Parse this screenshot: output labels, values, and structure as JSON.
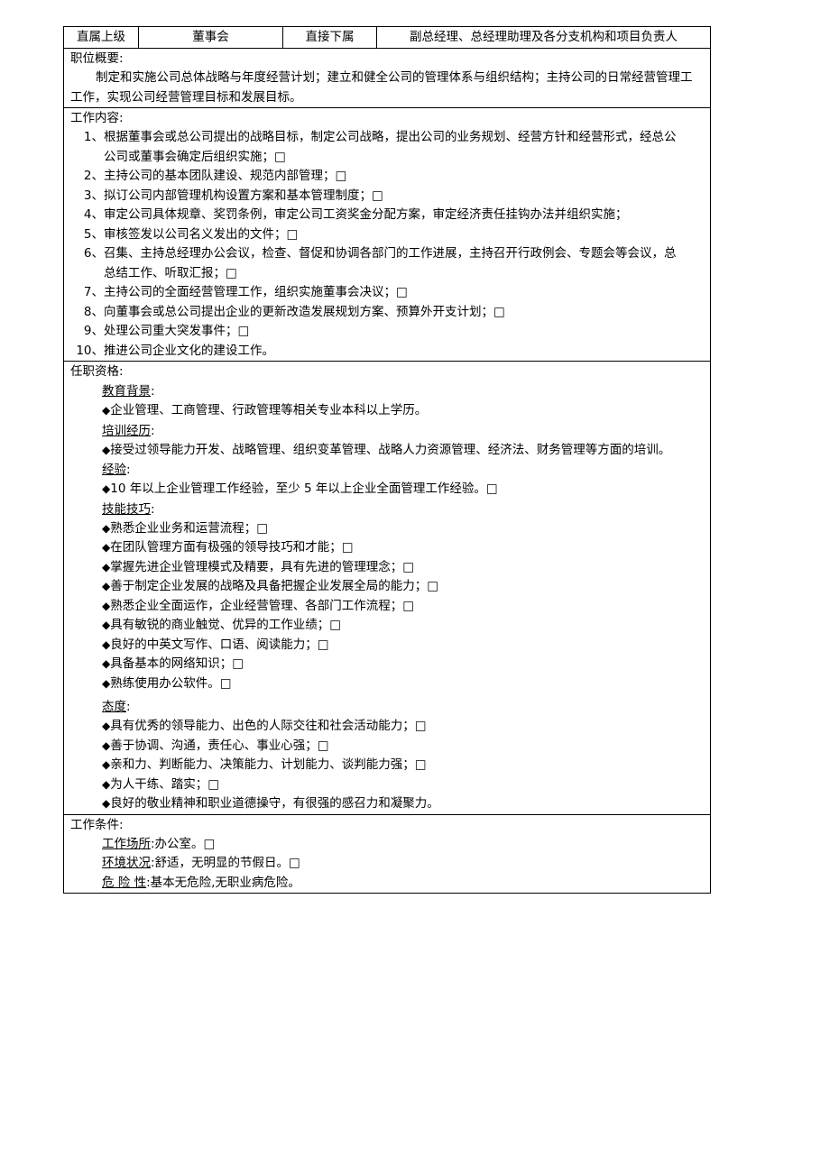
{
  "header": {
    "cells": [
      "直属上级",
      "董事会",
      "直接下属",
      "副总经理、总经理助理及各分支机构和项目负责人"
    ]
  },
  "summary": {
    "title": "职位概要:",
    "line1": "制定和实施公司总体战略与年度经营计划；建立和健全公司的管理体系与组织结构；主持公司的日常经营管理工",
    "line2": "工作，实现公司经营管理目标和发展目标。"
  },
  "duties": {
    "title": "工作内容:",
    "items": [
      {
        "num": "1、",
        "text": "根据董事会或总公司提出的战略目标，制定公司战略，提出公司的业务规划、经营方针和经营形式，经总公",
        "cont": "公司或董事会确定后组织实施；□"
      },
      {
        "num": "2、",
        "text": "主持公司的基本团队建设、规范内部管理；□",
        "cont": ""
      },
      {
        "num": "3、",
        "text": "拟订公司内部管理机构设置方案和基本管理制度；□",
        "cont": ""
      },
      {
        "num": "4、",
        "text": "审定公司具体规章、奖罚条例，审定公司工资奖金分配方案，审定经济责任挂钩办法并组织实施；",
        "cont": ""
      },
      {
        "num": "5、",
        "text": "审核签发以公司名义发出的文件；□",
        "cont": ""
      },
      {
        "num": "6、",
        "text": "召集、主持总经理办公会议，检查、督促和协调各部门的工作进展，主持召开行政例会、专题会等会议，总",
        "cont": "总结工作、听取汇报；□"
      },
      {
        "num": "7、",
        "text": "主持公司的全面经营管理工作，组织实施董事会决议；□",
        "cont": ""
      },
      {
        "num": "8、",
        "text": "向董事会或总公司提出企业的更新改造发展规划方案、预算外开支计划；□",
        "cont": ""
      },
      {
        "num": "9、",
        "text": "处理公司重大突发事件；□",
        "cont": ""
      },
      {
        "num": "10、",
        "text": "推进公司企业文化的建设工作。",
        "cont": ""
      }
    ]
  },
  "qualifications": {
    "title": "任职资格:",
    "groups": [
      {
        "heading": "教育背景",
        "heading_suffix": ":",
        "items": [
          "企业管理、工商管理、行政管理等相关专业本科以上学历。"
        ]
      },
      {
        "heading": "培训经历",
        "heading_suffix": ":",
        "items": [
          "接受过领导能力开发、战略管理、组织变革管理、战略人力资源管理、经济法、财务管理等方面的培训。"
        ]
      },
      {
        "heading": "经验",
        "heading_suffix": ":",
        "items": [
          "10 年以上企业管理工作经验，至少 5 年以上企业全面管理工作经验。□"
        ]
      },
      {
        "heading": "技能技巧",
        "heading_suffix": ":",
        "items": [
          "熟悉企业业务和运营流程；□",
          "在团队管理方面有极强的领导技巧和才能；□",
          "掌握先进企业管理模式及精要，具有先进的管理理念；□",
          "善于制定企业发展的战略及具备把握企业发展全局的能力；□",
          "熟悉企业全面运作，企业经营管理、各部门工作流程；□",
          "具有敏锐的商业触觉、优异的工作业绩；□",
          "良好的中英文写作、口语、阅读能力；□",
          "具备基本的网络知识；□",
          "熟练使用办公软件。□"
        ]
      },
      {
        "heading": "态度",
        "heading_suffix": ":",
        "items": [
          "具有优秀的领导能力、出色的人际交往和社会活动能力；□",
          "善于协调、沟通，责任心、事业心强；□",
          "亲和力、判断能力、决策能力、计划能力、谈判能力强；□",
          "为人干练、踏实；□",
          "良好的敬业精神和职业道德操守，有很强的感召力和凝聚力。"
        ]
      }
    ]
  },
  "work_conditions": {
    "title": "工作条件:",
    "items": [
      {
        "label": "工作场所",
        "value": ":办公室。□"
      },
      {
        "label": "环境状况",
        "value": ":舒适，无明显的节假日。□"
      },
      {
        "label": "危 险 性",
        "value": ":基本无危险,无职业病危险。"
      }
    ]
  },
  "symbols": {
    "diamond": "◆"
  }
}
